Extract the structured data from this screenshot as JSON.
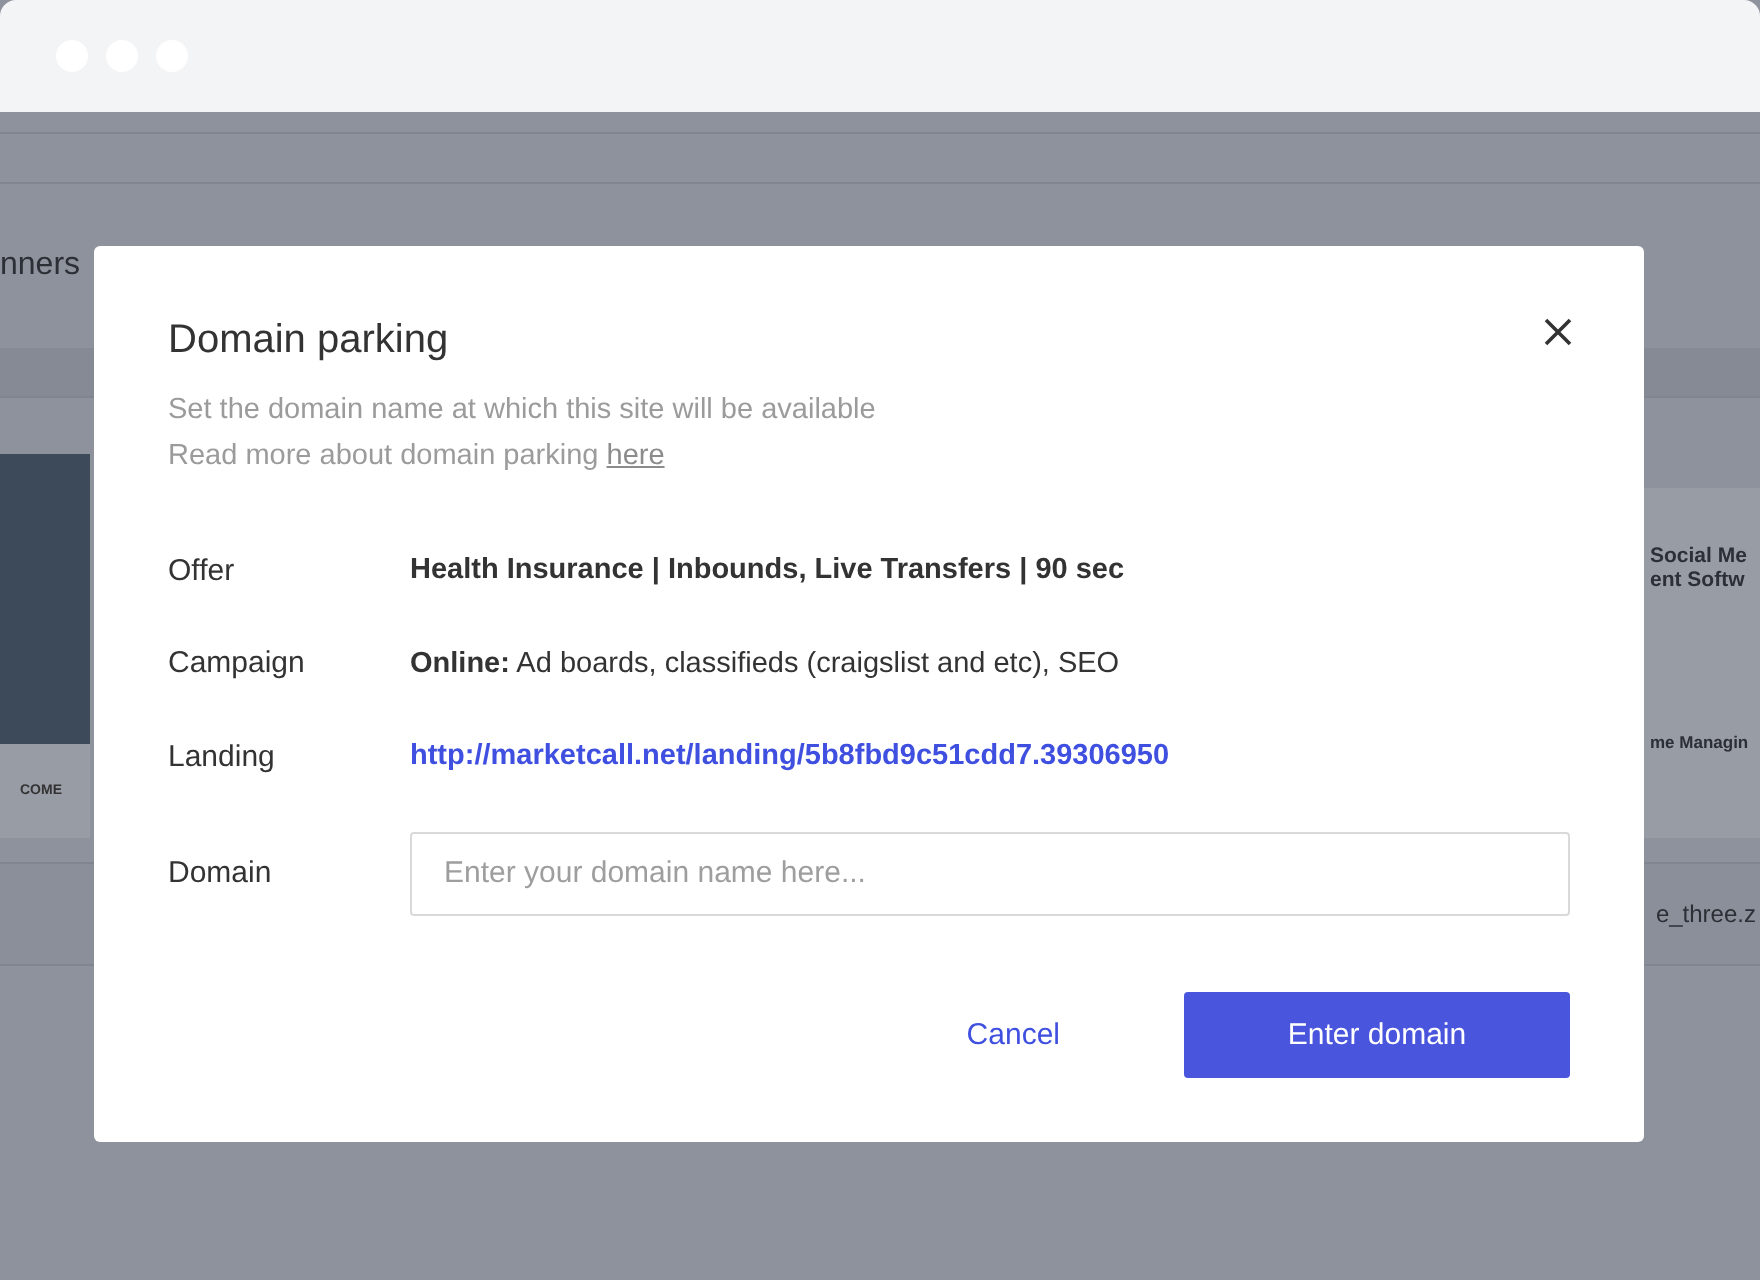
{
  "background": {
    "header_text": "nners",
    "left_card": {
      "caption": "COME"
    },
    "right_card": {
      "headline_1": "Social Me",
      "headline_2": "ent Softw",
      "caption": "me Managin"
    },
    "file_name": "e_three.z"
  },
  "dialog": {
    "title": "Domain parking",
    "subtitle": "Set the domain name at which this site will be available",
    "more_text": "Read more about domain parking ",
    "more_link": "here",
    "fields": [
      {
        "kind": "bold",
        "label": "Offer",
        "value": "Health Insurance | Inbounds, Live Transfers | 90 sec"
      },
      {
        "kind": "rich",
        "label": "Campaign",
        "value": "**Online:** Ad boards, classifieds (craigslist and etc), SEO"
      },
      {
        "kind": "link",
        "label": "Landing",
        "value": "http://marketcall.net/landing/5b8fbd9c51cdd7.39306950"
      }
    ],
    "domain": {
      "label": "Domain",
      "placeholder": "Enter your domain name here..."
    },
    "cancel": "Cancel",
    "submit": "Enter domain"
  }
}
